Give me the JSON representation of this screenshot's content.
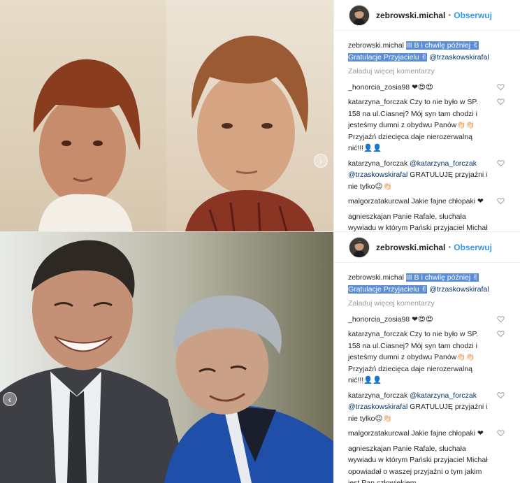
{
  "post": {
    "username": "zebrowski.michal",
    "follow_label": "Obserwuj",
    "dot": "•",
    "caption": {
      "user": "zebrowski.michal",
      "text_line1": "III B i chwilę później ✌",
      "text_line2": "Gratulacje Przyjacielu ✌",
      "mention": "@trzaskowskirafal"
    },
    "load_more": "Załaduj więcej komentarzy",
    "comments": [
      {
        "user": "_honorcia_zosia98",
        "text": " ❤😍😍"
      },
      {
        "user": "katarzyna_forczak",
        "text": " Czy to nie było w SP. 158 na ul.Ciasnej? Mój syn tam chodzi i jesteśmy dumni z obydwu Panów👏🏻👏🏻 Przyjaźń dziecięca daje nierozerwalną nić!!!👤👤"
      },
      {
        "user": "katarzyna_forczak",
        "mention1": " @katarzyna_forczak",
        "mention2": " @trzaskowskirafal",
        "text": " GRATULUJĘ przyjaźni i nie tylko😉👏🏻"
      },
      {
        "user": "malgorzatakurcwal",
        "text": " Jakie fajne chłopaki ❤"
      },
      {
        "user": "agnieszkajan",
        "text": " Panie Rafale, słuchała wywiadu w którym Pański przyjaciel Michał opowiadał o waszej przyjaźni o tym jakim jest Pan człowiekiem."
      }
    ]
  },
  "colors": {
    "accent": "#3897f0",
    "highlight": "#5b8ed7",
    "muted": "#999999",
    "text": "#262626"
  },
  "icons": {
    "carousel_next": "›",
    "carousel_prev": "‹",
    "heart": "heart-outline-icon"
  }
}
